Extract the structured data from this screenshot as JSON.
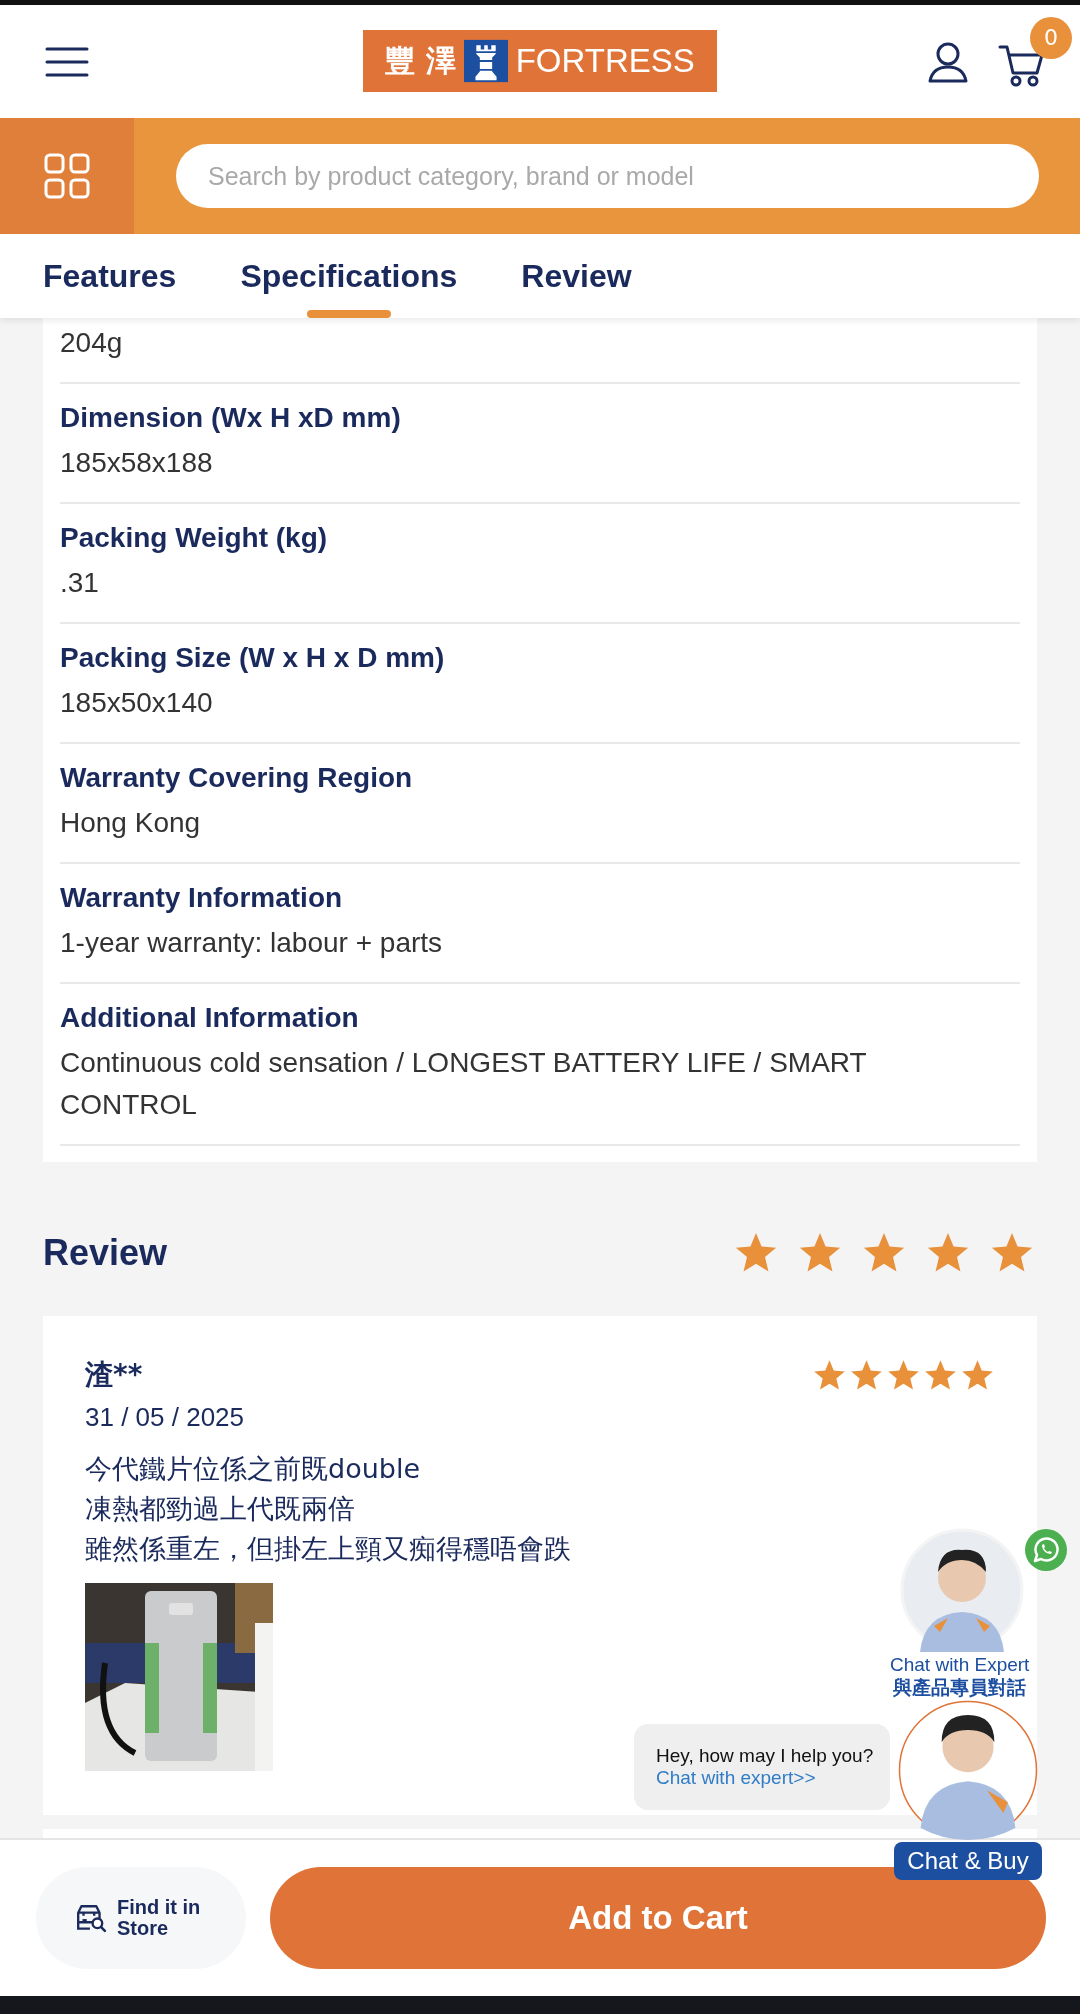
{
  "header": {
    "logo": {
      "chinese": "豐 澤",
      "english": "FORTRESS"
    },
    "cart_count": "0"
  },
  "search": {
    "placeholder": "Search by product category, brand or model"
  },
  "tabs": [
    {
      "label": "Features",
      "selected": false
    },
    {
      "label": "Specifications",
      "selected": true
    },
    {
      "label": "Review",
      "selected": false
    }
  ],
  "specifications": [
    {
      "value": "204g"
    },
    {
      "label": "Dimension (Wx H xD mm)",
      "value": "185x58x188"
    },
    {
      "label": "Packing Weight (kg)",
      "value": ".31"
    },
    {
      "label": "Packing Size (W x H x D mm)",
      "value": "185x50x140"
    },
    {
      "label": "Warranty Covering Region",
      "value": "Hong Kong"
    },
    {
      "label": "Warranty Information",
      "value": "1-year warranty: labour + parts"
    },
    {
      "label": "Additional Information",
      "value": "Continuous cold sensation / LONGEST BATTERY LIFE / SMART CONTROL"
    }
  ],
  "review_summary": {
    "title": "Review",
    "stars": 5
  },
  "reviews": [
    {
      "name": "渣**",
      "date": "31 / 05 / 2025",
      "stars": 5,
      "lines": [
        "今代鐵片位係之前既double",
        "凍熱都勁過上代既兩倍",
        "雖然係重左，但掛左上頸又痴得穩唔會跌"
      ]
    }
  ],
  "chat": {
    "expert_label": "Chat with Expert",
    "expert_label_zh": "與產品專員對話",
    "bubble_text": "Hey, how may I help you?",
    "bubble_link": "Chat with expert>>",
    "buy_label": "Chat & Buy"
  },
  "bottom_bar": {
    "store_button": "Find it in Store",
    "cart_button": "Add to Cart"
  }
}
